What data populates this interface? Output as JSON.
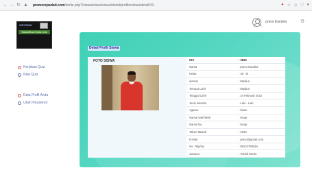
{
  "browser": {
    "url_host": "premorepadati.com",
    "url_path": "/smile.php?/siswa/siswa/siswa/detail/profile/siswa/detail/19",
    "nav_back": "←",
    "nav_forward": "→",
    "nav_reload": "↻",
    "site_icon": "lock-icon"
  },
  "header": {
    "username": "pravo Kandira"
  },
  "sidebar": {
    "logo_text": "SIFORMA",
    "logo_badge": "Siswa/Siswi Kelas Smk",
    "items": [
      {
        "label": "Kerjakan Quiz",
        "icon": "circle-icon"
      },
      {
        "label": "Nilai Quiz",
        "icon": "circle-icon"
      },
      {
        "label": "Data Profil Anda",
        "icon": "circle-icon"
      },
      {
        "label": "Ubah Password",
        "icon": "circle-icon"
      }
    ]
  },
  "main": {
    "card_title": "Detail Profil Siswa",
    "photo_label": "FOTO SISWA",
    "table": {
      "headers": [
        "NIS",
        ": 0832"
      ],
      "rows": [
        {
          "key": "Nama",
          "value": ": pravo Kandira"
        },
        {
          "key": "Kelas",
          "value": ": XII - B"
        },
        {
          "key": "alamat",
          "value": ": Madiun"
        },
        {
          "key": "Tempat Lahir",
          "value": ": Madiun"
        },
        {
          "key": "Tanggal Lahir",
          "value": ": 24 Februari 2022"
        },
        {
          "key": "Jenis kelamin",
          "value": ": Laki - Laki"
        },
        {
          "key": "Agama",
          "value": ": Islam"
        },
        {
          "key": "Nama Ayah/Wali",
          "value": ": Huap"
        },
        {
          "key": "Nama Ibu",
          "value": ": Huap"
        },
        {
          "key": "Tahun Masuk",
          "value": ": 2019"
        },
        {
          "key": "E-Mail",
          "value": ": pravo@gmail.com"
        },
        {
          "key": "No. Telp/Hp",
          "value": ": 08123789516"
        },
        {
          "key": "Jurusan",
          "value": ": Teknik Mesin"
        }
      ]
    }
  }
}
